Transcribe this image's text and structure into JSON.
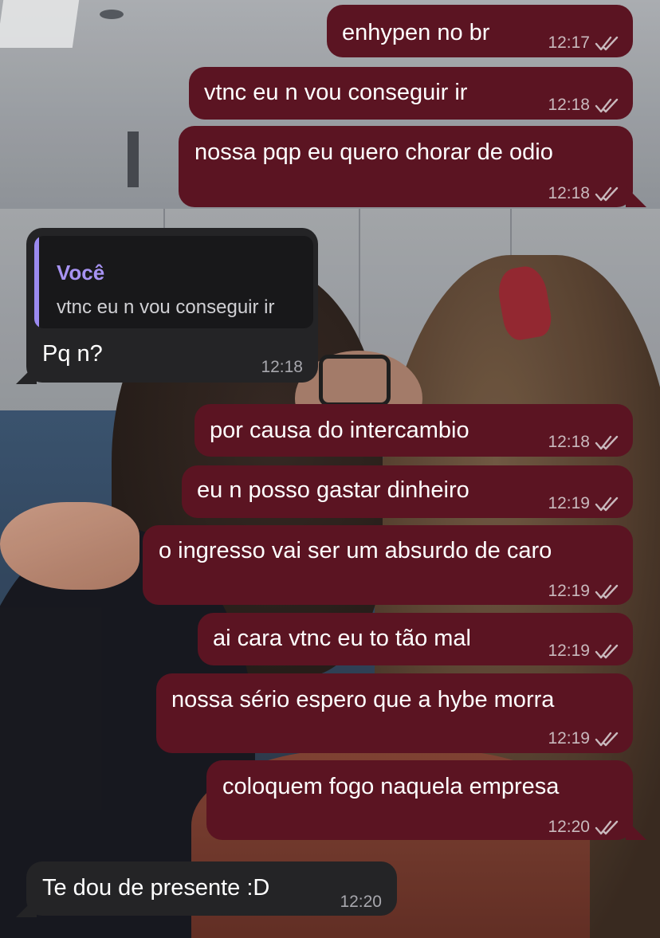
{
  "colors": {
    "outgoing_bubble": "#5b1422",
    "incoming_bubble": "#242426",
    "reply_accent": "#9b8af0"
  },
  "messages": [
    {
      "direction": "out",
      "text": "enhypen no br",
      "time": "12:17",
      "status_icon": "double-check-icon"
    },
    {
      "direction": "out",
      "text": "vtnc eu n vou conseguir ir",
      "time": "12:18",
      "status_icon": "double-check-icon"
    },
    {
      "direction": "out",
      "text": "nossa pqp eu quero chorar de odio",
      "time": "12:18",
      "status_icon": "double-check-icon"
    },
    {
      "direction": "in",
      "reply": {
        "author": "Você",
        "text": "vtnc eu n vou conseguir ir"
      },
      "text": "Pq n?",
      "time": "12:18"
    },
    {
      "direction": "out",
      "text": "por causa do intercambio",
      "time": "12:18",
      "status_icon": "double-check-icon"
    },
    {
      "direction": "out",
      "text": "eu n posso gastar dinheiro",
      "time": "12:19",
      "status_icon": "double-check-icon"
    },
    {
      "direction": "out",
      "text": "o ingresso vai ser um absurdo de caro",
      "time": "12:19",
      "status_icon": "double-check-icon"
    },
    {
      "direction": "out",
      "text": "ai cara vtnc eu to tão mal",
      "time": "12:19",
      "status_icon": "double-check-icon"
    },
    {
      "direction": "out",
      "text": "nossa sério espero que a hybe morra",
      "time": "12:19",
      "status_icon": "double-check-icon"
    },
    {
      "direction": "out",
      "text": "coloquem fogo naquela empresa",
      "time": "12:20",
      "status_icon": "double-check-icon"
    },
    {
      "direction": "in",
      "text": "Te dou de presente :D",
      "time": "12:20"
    }
  ]
}
